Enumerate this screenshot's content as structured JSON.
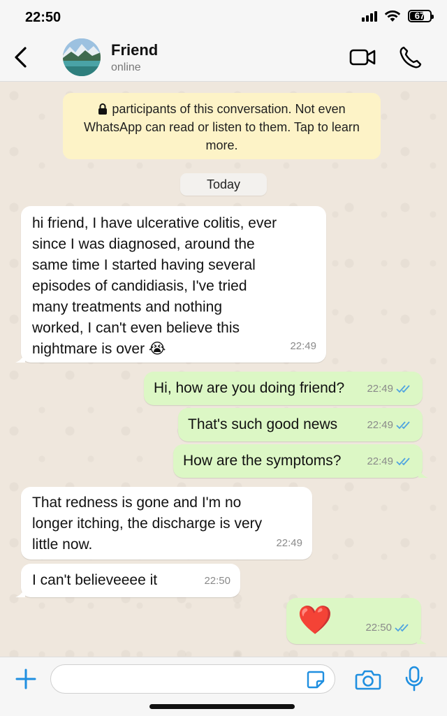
{
  "status_bar": {
    "time": "22:50",
    "battery": "67"
  },
  "header": {
    "contact_name": "Friend",
    "contact_status": "online"
  },
  "encryption_notice": "participants of this conversation. Not even WhatsApp can read or listen to them. Tap to learn more.",
  "date_divider": "Today",
  "messages": [
    {
      "direction": "in",
      "text": "hi friend, I have ulcerative colitis, ever\nsince I was diagnosed, around the\nsame time I started having several\nepisodes of candidiasis, I've tried\nmany treatments and nothing\nworked, I can't even believe this\nnightmare is over 😭",
      "time": "22:49"
    },
    {
      "direction": "out",
      "text": "Hi, how are you doing friend?",
      "time": "22:49",
      "read": true
    },
    {
      "direction": "out",
      "text": "That's such good news",
      "time": "22:49",
      "read": true
    },
    {
      "direction": "out",
      "text": "How are the symptoms?",
      "time": "22:49",
      "read": true
    },
    {
      "direction": "in",
      "text": "That redness is gone and I'm no\nlonger itching, the discharge is very\nlittle now.",
      "time": "22:49"
    },
    {
      "direction": "in",
      "text": "I can't believeeee it",
      "time": "22:50"
    },
    {
      "direction": "out",
      "text": "❤️",
      "time": "22:50",
      "read": true
    }
  ],
  "input": {
    "placeholder": "",
    "value": ""
  },
  "colors": {
    "incoming_bubble": "#ffffff",
    "outgoing_bubble": "#dcf7c5",
    "read_ticks": "#4fa3e0",
    "accent": "#1f8fe0",
    "wallpaper": "#efe7dd",
    "encryption_notice_bg": "#fdf3c7"
  },
  "icons": [
    "back-chevron-icon",
    "video-call-icon",
    "phone-call-icon",
    "lock-icon",
    "double-check-icon",
    "plus-icon",
    "sticker-icon",
    "camera-icon",
    "microphone-icon"
  ]
}
